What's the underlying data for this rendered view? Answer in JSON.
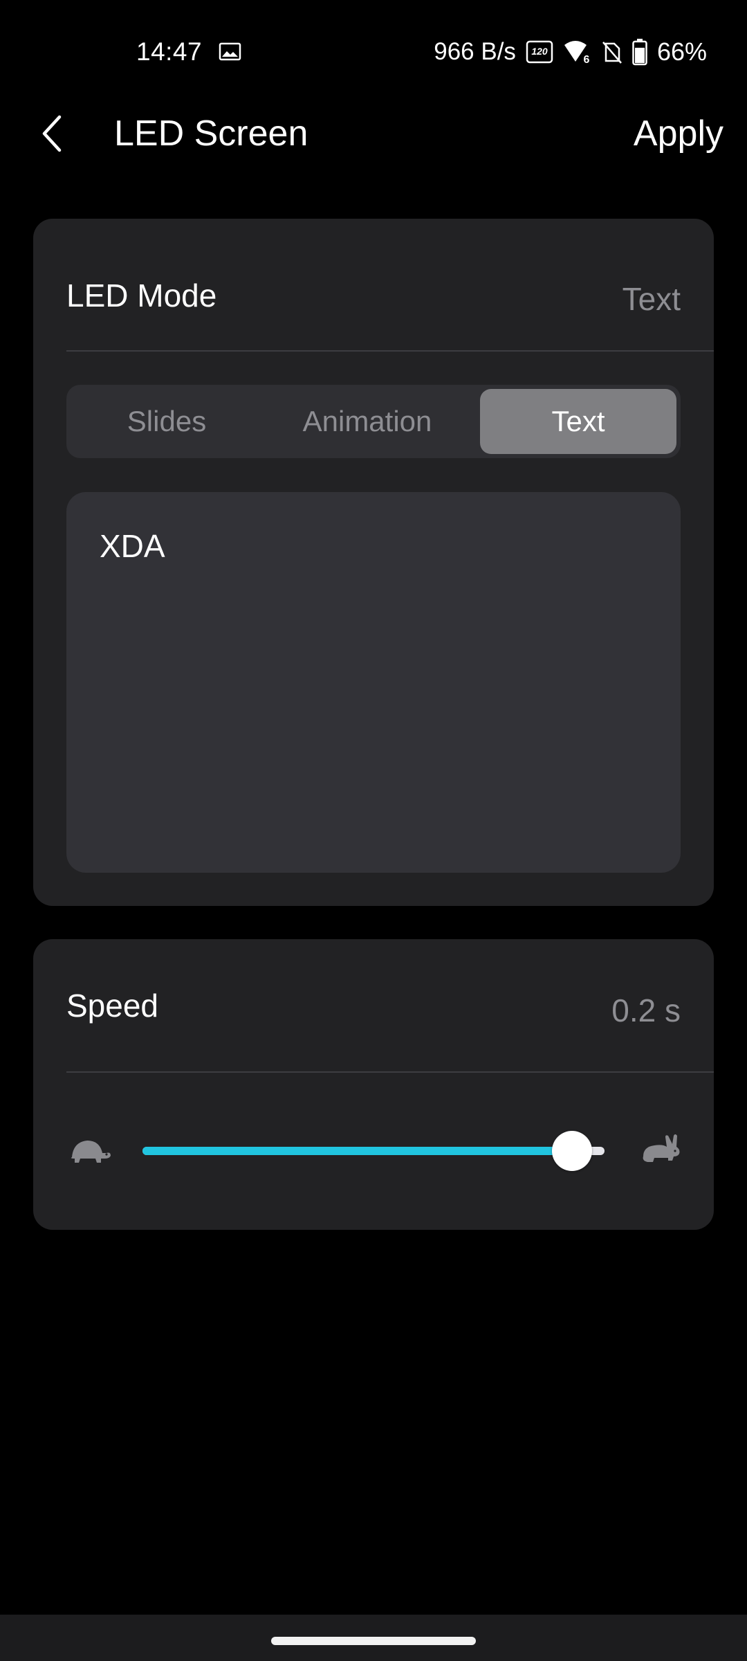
{
  "status_bar": {
    "time": "14:47",
    "net_speed": "966 B/s",
    "refresh_badge": "120",
    "battery_percent": "66%",
    "icons": [
      "gallery-icon",
      "refresh-rate-icon",
      "wifi-6-icon",
      "no-sim-icon",
      "battery-icon"
    ]
  },
  "app_bar": {
    "title": "LED Screen",
    "apply_label": "Apply",
    "back_icon": "chevron-left-icon"
  },
  "led_mode": {
    "label": "LED Mode",
    "current_value": "Text",
    "tabs": [
      {
        "label": "Slides",
        "selected": false
      },
      {
        "label": "Animation",
        "selected": false
      },
      {
        "label": "Text",
        "selected": true
      }
    ],
    "text_value": "XDA"
  },
  "speed": {
    "label": "Speed",
    "value": "0.2 s",
    "slider_fraction": 0.93,
    "slow_icon": "turtle-icon",
    "fast_icon": "rabbit-icon",
    "accent_color": "#21c5e0"
  }
}
